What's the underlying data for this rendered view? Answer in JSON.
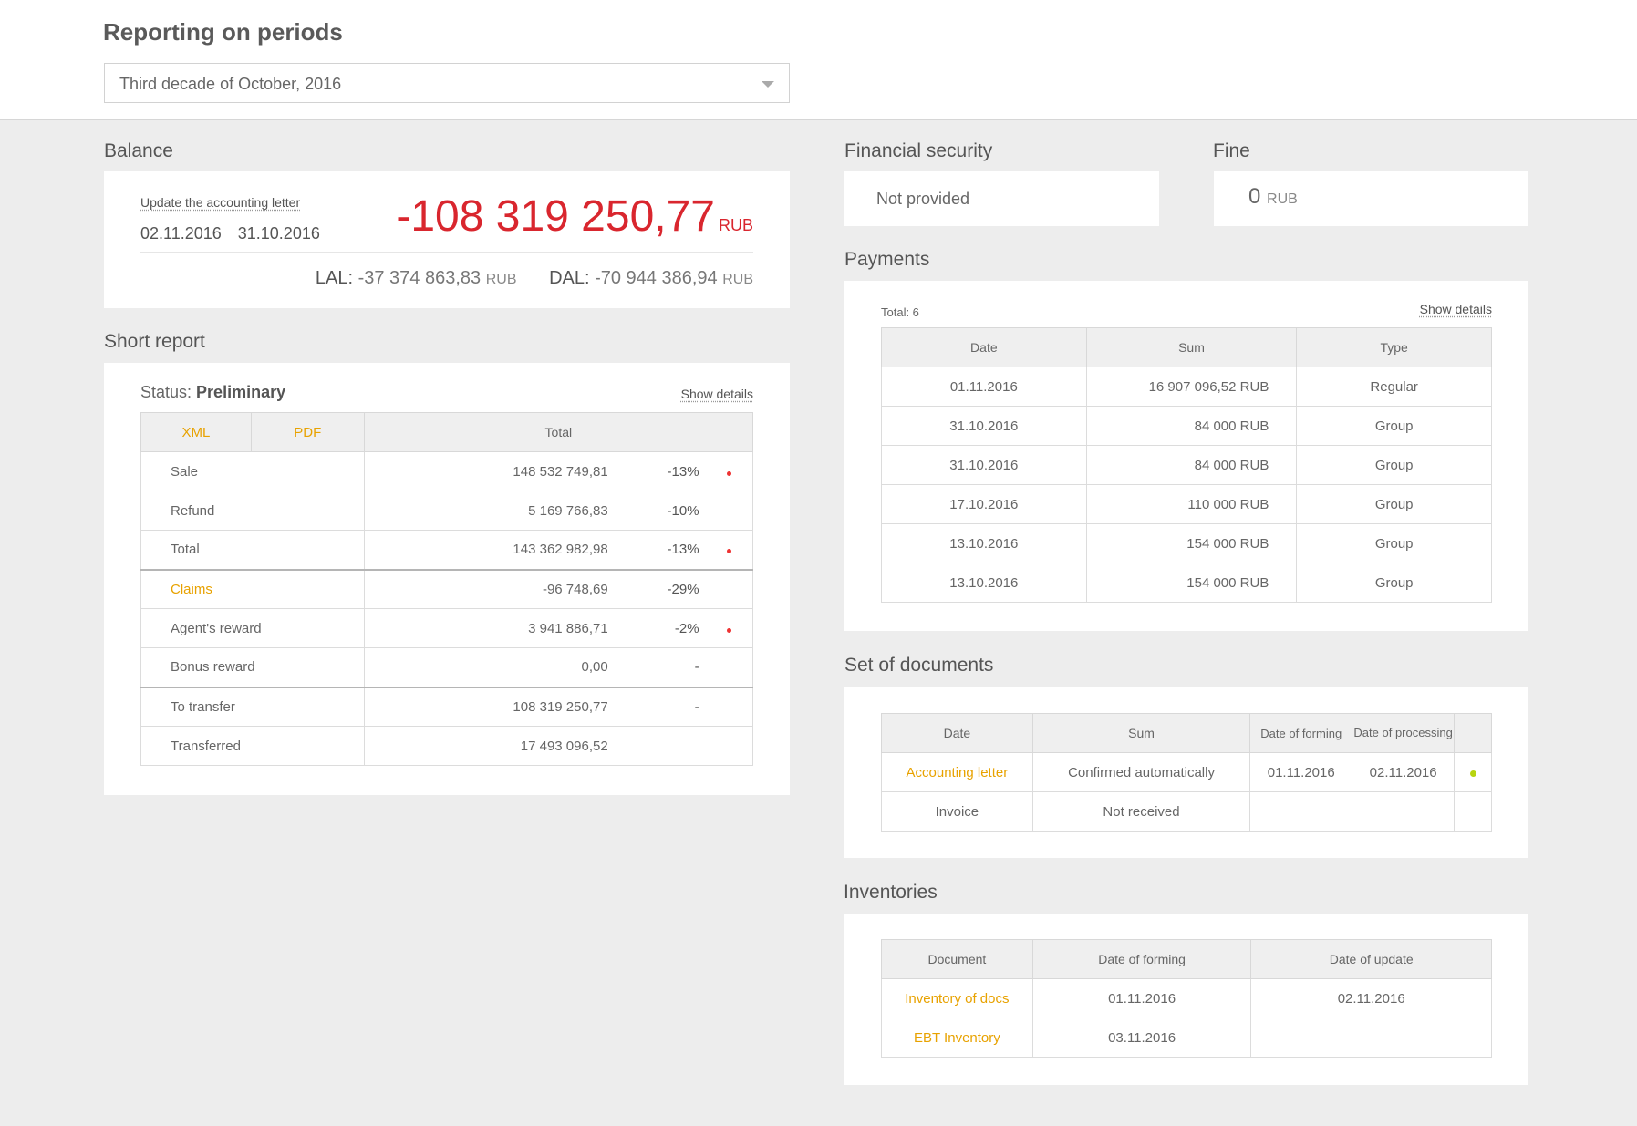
{
  "header": {
    "title": "Reporting on periods",
    "period_value": "Third decade of October, 2016"
  },
  "balance": {
    "title": "Balance",
    "update_link": "Update the accounting letter",
    "date1": "02.11.2016",
    "date2": "31.10.2016",
    "amount": "-108 319 250,77",
    "currency": "RUB",
    "lal_label": "LAL:",
    "lal_value": "-37 374 863,83",
    "dal_label": "DAL:",
    "dal_value": "-70 944 386,94"
  },
  "short_report": {
    "title": "Short report",
    "status_label": "Status:",
    "status_value": "Preliminary",
    "show_details": "Show details",
    "col_xml": "XML",
    "col_pdf": "PDF",
    "col_total": "Total",
    "rows": [
      {
        "label": "Sale",
        "value": "148 532 749,81",
        "pct": "-13%",
        "dot": true
      },
      {
        "label": "Refund",
        "value": "5 169 766,83",
        "pct": "-10%",
        "dot": false
      },
      {
        "label": "Total",
        "value": "143 362 982,98",
        "pct": "-13%",
        "dot": true
      },
      {
        "label": "Claims",
        "value": "-96 748,69",
        "pct": "-29%",
        "dot": false
      },
      {
        "label": "Agent's reward",
        "value": "3 941 886,71",
        "pct": "-2%",
        "dot": true
      },
      {
        "label": "Bonus reward",
        "value": "0,00",
        "pct": "-",
        "dot": false
      },
      {
        "label": "To transfer",
        "value": "108 319 250,77",
        "pct": "-",
        "dot": false
      },
      {
        "label": "Transferred",
        "value": "17 493 096,52",
        "pct": "",
        "dot": false
      }
    ]
  },
  "financial_security": {
    "title": "Financial security",
    "value": "Not provided"
  },
  "fine": {
    "title": "Fine",
    "value": "0",
    "currency": "RUB"
  },
  "payments": {
    "title": "Payments",
    "total": "Total: 6",
    "show_details": "Show details",
    "columns": [
      "Date",
      "Sum",
      "Type"
    ],
    "rows": [
      {
        "date": "01.11.2016",
        "sum": "16 907 096,52 RUB",
        "type": "Regular"
      },
      {
        "date": "31.10.2016",
        "sum": "84 000 RUB",
        "type": "Group"
      },
      {
        "date": "31.10.2016",
        "sum": "84 000 RUB",
        "type": "Group"
      },
      {
        "date": "17.10.2016",
        "sum": "110 000 RUB",
        "type": "Group"
      },
      {
        "date": "13.10.2016",
        "sum": "154 000 RUB",
        "type": "Group"
      },
      {
        "date": "13.10.2016",
        "sum": "154 000 RUB",
        "type": "Group"
      }
    ]
  },
  "documents": {
    "title": "Set of documents",
    "columns": [
      "Date",
      "Sum",
      "Date of forming",
      "Date of processing"
    ],
    "rows": [
      {
        "name": "Accounting letter",
        "sum": "Confirmed automatically",
        "forming": "01.11.2016",
        "processing": "02.11.2016"
      },
      {
        "name": "Invoice",
        "sum": "Not received",
        "forming": "",
        "processing": ""
      }
    ]
  },
  "inventories": {
    "title": "Inventories",
    "columns": [
      "Document",
      "Date of forming",
      "Date of update"
    ],
    "rows": [
      {
        "name": "Inventory of docs",
        "forming": "01.11.2016",
        "update": "02.11.2016"
      },
      {
        "name": "EBT Inventory",
        "forming": "03.11.2016",
        "update": ""
      }
    ]
  },
  "colors": {
    "accent": "#e8a200",
    "negative": "#d9262e",
    "ok": "#b7d40f"
  }
}
